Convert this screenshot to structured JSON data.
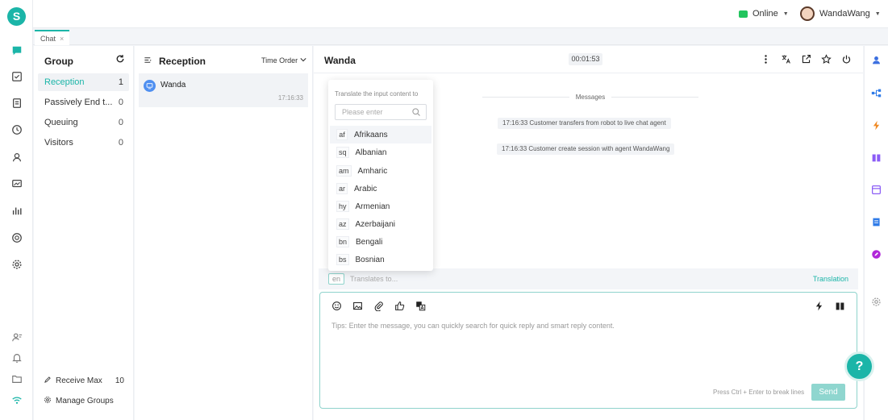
{
  "app": {
    "logo_letter": "S"
  },
  "topbar": {
    "status_label": "Online",
    "user_name": "WandaWang"
  },
  "tabs": [
    {
      "label": "Chat",
      "close": "×"
    }
  ],
  "rail_icons": [
    "chat-icon",
    "task-icon",
    "document-icon",
    "history-icon",
    "contacts-icon",
    "monitor-icon",
    "stats-icon",
    "headset-icon",
    "settings-icon",
    "user-config-icon",
    "bell-icon",
    "folder-icon",
    "wifi-icon"
  ],
  "group_panel": {
    "title": "Group",
    "items": [
      {
        "label": "Reception",
        "count": "1"
      },
      {
        "label": "Passively End t...",
        "count": "0"
      },
      {
        "label": "Queuing",
        "count": "0"
      },
      {
        "label": "Visitors",
        "count": "0"
      }
    ],
    "receive_max_label": "Receive Max",
    "receive_max_value": "10",
    "manage_groups_label": "Manage Groups"
  },
  "session_panel": {
    "title": "Reception",
    "sort_label": "Time Order",
    "sessions": [
      {
        "name": "Wanda",
        "time": "17:16:33"
      }
    ]
  },
  "chat": {
    "title": "Wanda",
    "timer": "00:01:53",
    "divider_label": "Messages",
    "system_messages": [
      "17:16:33 Customer transfers from robot to live chat agent",
      "17:16:33 Customer create session with agent WandaWang"
    ],
    "translation_bar": {
      "lang_code": "en",
      "placeholder": "Translates to...",
      "link": "Translation"
    },
    "editor": {
      "tips": "Tips: Enter the message, you can quickly search for quick reply and smart reply content.",
      "hint": "Press Ctrl + Enter to break lines",
      "send_label": "Send"
    }
  },
  "language_dropdown": {
    "title": "Translate the input content to",
    "search_placeholder": "Please enter",
    "options": [
      {
        "code": "af",
        "name": "Afrikaans"
      },
      {
        "code": "sq",
        "name": "Albanian"
      },
      {
        "code": "am",
        "name": "Amharic"
      },
      {
        "code": "ar",
        "name": "Arabic"
      },
      {
        "code": "hy",
        "name": "Armenian"
      },
      {
        "code": "az",
        "name": "Azerbaijani"
      },
      {
        "code": "bn",
        "name": "Bengali"
      },
      {
        "code": "bs",
        "name": "Bosnian"
      }
    ]
  },
  "help": {
    "label": "?"
  },
  "colors": {
    "accent": "#1bb5a8",
    "online": "#22c55e"
  }
}
